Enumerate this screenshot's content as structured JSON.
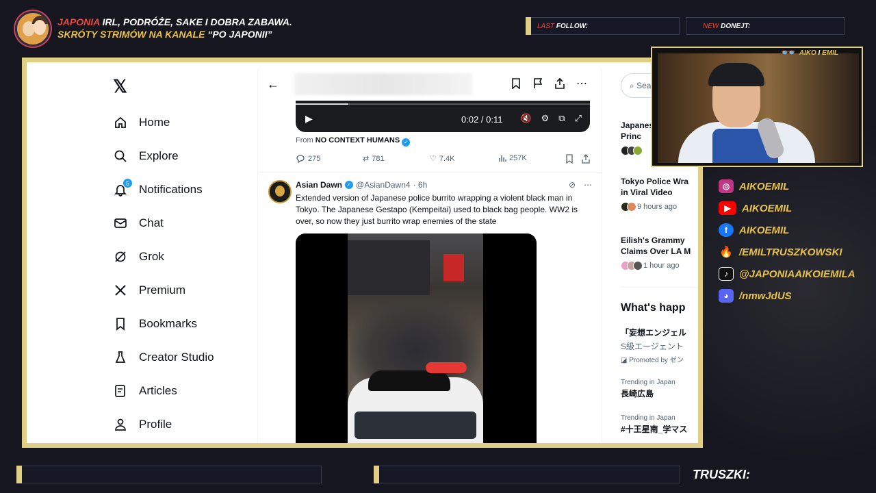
{
  "overlay": {
    "tagline_line1_red": "JAPONIA",
    "tagline_line1_rest": " IRL, PODRÓŻE, SAKE I DOBRA ZABAWA.",
    "tagline_line2_yellow": "SKRÓTY STRIMÓW NA KANALE ",
    "tagline_line2_white": "“PO JAPONII”",
    "last_follow_prefix": "LAST",
    "last_follow_label": " FOLLOW:",
    "new_donejt_prefix": "NEW",
    "new_donejt_label": " DONEJT:",
    "webcam_tag_yellow": "AIKO",
    "webcam_tag_white": " I ",
    "webcam_tag_yellow2": "EMIL",
    "truszki": "TRUSZKI:",
    "socials": [
      {
        "icon": "instagram-icon",
        "text": "AIKOEMIL",
        "color": "#c13584"
      },
      {
        "icon": "youtube-icon",
        "text": "AIKOEMIL",
        "color": "#ff0000"
      },
      {
        "icon": "facebook-icon",
        "text": "AIKOEMIL",
        "color": "#1877f2"
      },
      {
        "icon": "flame-icon",
        "text": "/EMILTRUSZKOWSKI",
        "color": "#e8493d"
      },
      {
        "icon": "tiktok-icon",
        "text": "@JAPONIAAIKOIEMILA",
        "color": "#111111"
      },
      {
        "icon": "discord-icon",
        "text": "/nmwJdUS",
        "color": "#5865f2"
      }
    ],
    "accent_yellow": "#e8c24a",
    "accent_red": "#e8493d"
  },
  "nav": {
    "items": [
      {
        "label": "Home",
        "icon": "home-icon"
      },
      {
        "label": "Explore",
        "icon": "search-icon"
      },
      {
        "label": "Notifications",
        "icon": "bell-icon",
        "badge": "5"
      },
      {
        "label": "Chat",
        "icon": "mail-icon"
      },
      {
        "label": "Grok",
        "icon": "grok-icon"
      },
      {
        "label": "Premium",
        "icon": "x-premium-icon"
      },
      {
        "label": "Bookmarks",
        "icon": "bookmark-icon"
      },
      {
        "label": "Creator Studio",
        "icon": "flask-icon"
      },
      {
        "label": "Articles",
        "icon": "article-icon"
      },
      {
        "label": "Profile",
        "icon": "person-icon"
      }
    ]
  },
  "video1": {
    "time": "0:02 / 0:11",
    "progress": 0.18
  },
  "tweet1": {
    "from_prefix": "From ",
    "from_account": "NO CONTEXT HUMANS",
    "replies": "275",
    "reposts": "781",
    "likes": "7.4K",
    "views": "257K"
  },
  "tweet2": {
    "name": "Asian Dawn",
    "handle": "@AsianDawn4",
    "time": "· 6h",
    "text": "Extended version of Japanese police burrito wrapping a violent black man in Tokyo. The Japanese Gestapo (Kempeitai) used to black bag people. WW2 is over, so now they just burrito wrap enemies of the state"
  },
  "right": {
    "search_placeholder": "Search",
    "news": [
      {
        "title1": "Japanese",
        "title2": "Princ",
        "meta": ""
      },
      {
        "title1": "Tokyo Police Wra",
        "title2": "in Viral Video",
        "meta": "9 hours ago"
      },
      {
        "title1": "Eilish's Grammy",
        "title2": "Claims Over LA M",
        "meta": "1 hour ago"
      }
    ],
    "whats_happening": "What's happ",
    "promo_title": "「妄想エンジェル",
    "promo_sub": "S級エージェント",
    "promo_by": "Promoted by ゼン",
    "trends": [
      {
        "label": "Trending in Japan",
        "title": "長崎広島"
      },
      {
        "label": "Trending in Japan",
        "title": "#十王星南_学マス"
      }
    ]
  }
}
